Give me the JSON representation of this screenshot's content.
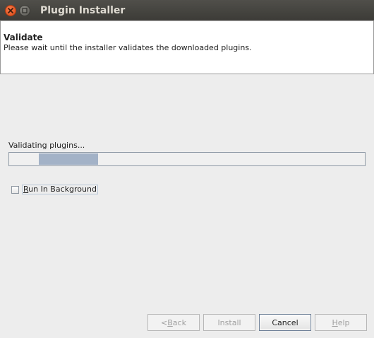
{
  "window": {
    "title": "Plugin Installer",
    "controls": {
      "close_icon": "close-icon",
      "maximize_icon": "maximize-icon"
    }
  },
  "header": {
    "title": "Validate",
    "description": "Please wait until the installer validates the downloaded plugins."
  },
  "progress": {
    "label": "Validating plugins...",
    "indeterminate": true,
    "fill_color": "#a3b2c7"
  },
  "checkbox": {
    "label_mnemonic": "R",
    "label_rest": "un In Background",
    "checked": false
  },
  "buttons": {
    "back": {
      "label_pre": "< ",
      "mnemonic": "B",
      "label_post": "ack",
      "enabled": false
    },
    "install": {
      "label": "Install",
      "enabled": false
    },
    "cancel": {
      "label": "Cancel",
      "enabled": true
    },
    "help": {
      "mnemonic": "H",
      "label_post": "elp",
      "enabled": false
    }
  }
}
